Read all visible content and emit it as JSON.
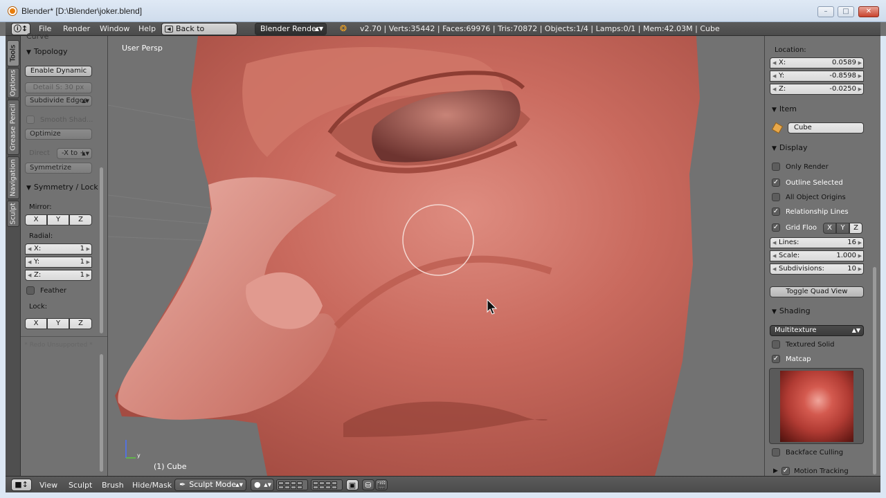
{
  "window": {
    "title": "Blender* [D:\\Blender\\joker.blend]",
    "minimize": "–",
    "maximize": "□",
    "close": "✕"
  },
  "info_header": {
    "menus": [
      "File",
      "Render",
      "Window",
      "Help"
    ],
    "back_button": "Back to Previous",
    "engine": "Blender Render",
    "stats": "v2.70 | Verts:35442 | Faces:69976 | Tris:70872 | Objects:1/4 | Lamps:0/1 | Mem:42.03M | Cube"
  },
  "tool_tabs": [
    "Tools",
    "Options",
    "Grease Pencil",
    "Navigation",
    "Sculpt"
  ],
  "tool_shelf": {
    "curve_partial": "Curve",
    "topology": {
      "header": "Topology",
      "enable_dynamic": "Enable Dynamic",
      "detail_size": "Detail S: 30 px",
      "subdivide_edges": "Subdivide Edges",
      "smooth_shading": "Smooth Shad...",
      "optimize": "Optimize",
      "direction_label": "Direct",
      "direction_value": "-X to +",
      "symmetrize": "Symmetrize"
    },
    "symmetry": {
      "header": "Symmetry / Lock",
      "mirror_label": "Mirror:",
      "mirror_axes": [
        "X",
        "Y",
        "Z"
      ],
      "radial_label": "Radial:",
      "radial": [
        {
          "label": "X:",
          "value": "1"
        },
        {
          "label": "Y:",
          "value": "1"
        },
        {
          "label": "Z:",
          "value": "1"
        }
      ],
      "feather": "Feather",
      "lock_label": "Lock:",
      "lock_axes": [
        "X",
        "Y",
        "Z"
      ]
    },
    "redo": "Redo Unsupported"
  },
  "viewport": {
    "view_name": "User Persp",
    "object_name": "(1) Cube",
    "axis_y": "y"
  },
  "properties": {
    "location_label": "Location:",
    "location": [
      {
        "label": "X:",
        "value": "0.0589"
      },
      {
        "label": "Y:",
        "value": "-0.8598"
      },
      {
        "label": "Z:",
        "value": "-0.0250"
      }
    ],
    "item_header": "Item",
    "item_name": "Cube",
    "display_header": "Display",
    "only_render": "Only Render",
    "outline_selected": "Outline Selected",
    "all_object_origins": "All Object Origins",
    "relationship_lines": "Relationship Lines",
    "grid_floor": "Grid Floo",
    "grid_axes": [
      "X",
      "Y",
      "Z"
    ],
    "grid_fields": [
      {
        "label": "Lines:",
        "value": "16"
      },
      {
        "label": "Scale:",
        "value": "1.000"
      },
      {
        "label": "Subdivisions:",
        "value": "10"
      }
    ],
    "toggle_quad": "Toggle Quad View",
    "shading_header": "Shading",
    "shading_mode": "Multitexture",
    "textured_solid": "Textured Solid",
    "matcap": "Matcap",
    "backface_culling": "Backface Culling",
    "motion_tracking": "Motion Tracking"
  },
  "bottom_header": {
    "menus": [
      "View",
      "Sculpt",
      "Brush",
      "Hide/Mask"
    ],
    "mode": "Sculpt Mode"
  },
  "colors": {
    "model_skin": "#c66559",
    "ui_panel": "#727272",
    "header": "#4b4b4b",
    "brush_circle": "#f4d8d2"
  }
}
